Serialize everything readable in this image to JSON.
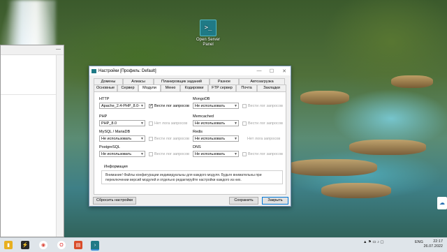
{
  "desktop": {
    "icon_label": "Open Server Panel",
    "icon_glyph": ">_"
  },
  "window": {
    "title": "Настройки [Профиль: Default]",
    "tabs_row1": [
      "Домены",
      "Алиасы",
      "Планировщик заданий",
      "Разное",
      "Автозагрузка"
    ],
    "tabs_row2": [
      "Основные",
      "Сервер",
      "Модули",
      "Меню",
      "Кодировки",
      "FTP сервер",
      "Почта",
      "Закладки"
    ],
    "active_tab": "Модули",
    "modules": {
      "http": {
        "label": "HTTP",
        "value": "Apache_2.4-PHP_8.0-",
        "log_label": "Вести лог запросов",
        "log_checked": true,
        "log_disabled": false
      },
      "mongodb": {
        "label": "MongoDB",
        "value": "Не использовать",
        "log_label": "Вести лог запросов",
        "log_disabled": true
      },
      "php": {
        "label": "PHP",
        "value": "PHP_8.0",
        "log_label": "Нет лога запросов",
        "log_disabled": true
      },
      "memcached": {
        "label": "Memcached",
        "value": "Не использовать",
        "log_label": "Вести лог запросов",
        "log_disabled": true
      },
      "mysql": {
        "label": "MySQL / MariaDB",
        "value": "Не использовать",
        "log_label": "Вести лог запросов",
        "log_disabled": true
      },
      "redis": {
        "label": "Redis",
        "value": "Не использовать",
        "log_label": "Нет лога запросов",
        "log_disabled": true
      },
      "postgresql": {
        "label": "PostgreSQL",
        "value": "Не использовать",
        "log_label": "Вести лог запросов",
        "log_disabled": true
      },
      "dns": {
        "label": "DNS",
        "value": "Не использовать",
        "log_label": "Вести лог запросов",
        "log_disabled": true
      }
    },
    "info_title": "Информация",
    "info_text": "Внимание! Файлы конфигурации индивидуальны для каждого модуля. Будьте внимательны при переключении версий модулей и отдельно редактируйте настройки каждого из них.",
    "reset_label": "Сбросить настройки",
    "save_label": "Сохранить",
    "close_label": "Закрыть"
  },
  "taskbar": {
    "lang": "ENG",
    "time": "22:17",
    "date": "26.07.2022"
  }
}
